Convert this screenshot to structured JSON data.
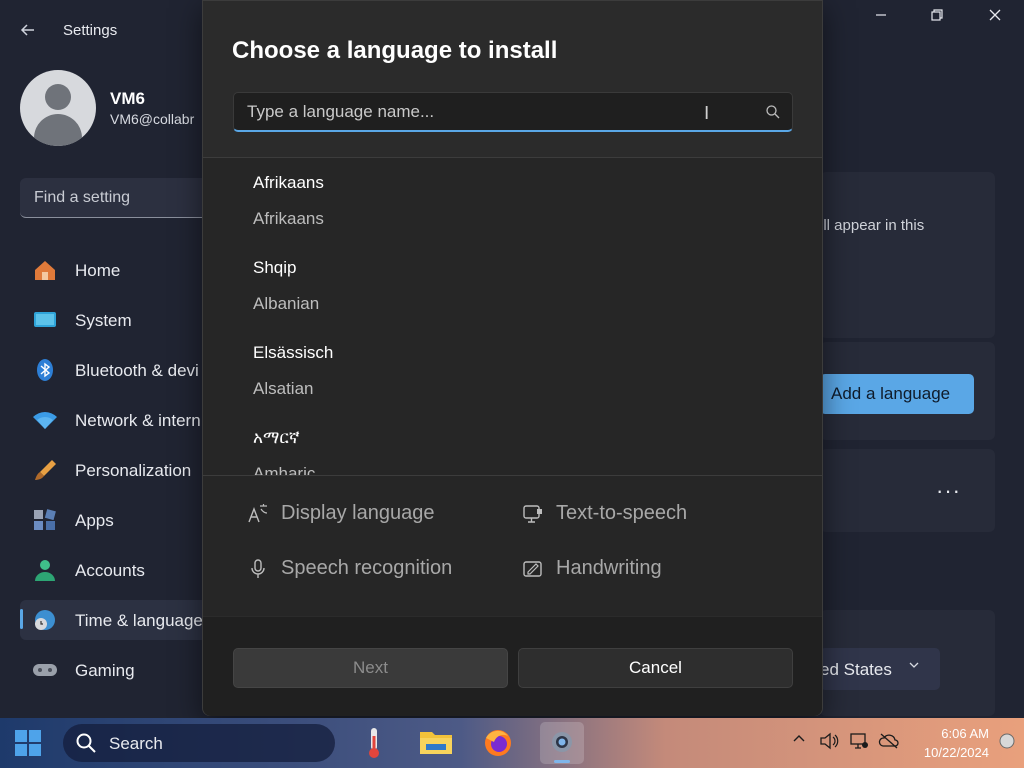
{
  "settings": {
    "title": "Settings",
    "user": {
      "name": "VM6",
      "email": "VM6@collabr"
    },
    "find_placeholder": "Find a setting",
    "nav": [
      {
        "label": "Home",
        "icon": "home-icon"
      },
      {
        "label": "System",
        "icon": "system-icon"
      },
      {
        "label": "Bluetooth & devi",
        "icon": "bluetooth-icon"
      },
      {
        "label": "Network & intern",
        "icon": "network-icon"
      },
      {
        "label": "Personalization",
        "icon": "personalization-icon"
      },
      {
        "label": "Apps",
        "icon": "apps-icon"
      },
      {
        "label": "Accounts",
        "icon": "accounts-icon"
      },
      {
        "label": "Time & language",
        "icon": "time-language-icon"
      },
      {
        "label": "Gaming",
        "icon": "gaming-icon"
      }
    ],
    "active_nav": "Time & language",
    "right": {
      "info_text": "ill appear in this",
      "add_language_label": "Add a language",
      "more_label": "···",
      "region_value": "ed States"
    }
  },
  "dialog": {
    "title": "Choose a language to install",
    "search_placeholder": "Type a language name...",
    "languages": [
      {
        "native": "Afrikaans",
        "english": "Afrikaans"
      },
      {
        "native": "Shqip",
        "english": "Albanian"
      },
      {
        "native": "Elsässisch",
        "english": "Alsatian"
      },
      {
        "native": "አማርኛ",
        "english": "Amharic"
      }
    ],
    "features": [
      {
        "label": "Display language",
        "icon": "display-language-icon"
      },
      {
        "label": "Text-to-speech",
        "icon": "text-to-speech-icon"
      },
      {
        "label": "Speech recognition",
        "icon": "microphone-icon"
      },
      {
        "label": "Handwriting",
        "icon": "handwriting-icon"
      }
    ],
    "next_label": "Next",
    "cancel_label": "Cancel"
  },
  "taskbar": {
    "search_label": "Search",
    "time": "6:06 AM",
    "date": "10/22/2024"
  },
  "colors": {
    "accent": "#5aa7e6",
    "dialog_bg": "#2b2b2b",
    "settings_bg": "#202432"
  }
}
